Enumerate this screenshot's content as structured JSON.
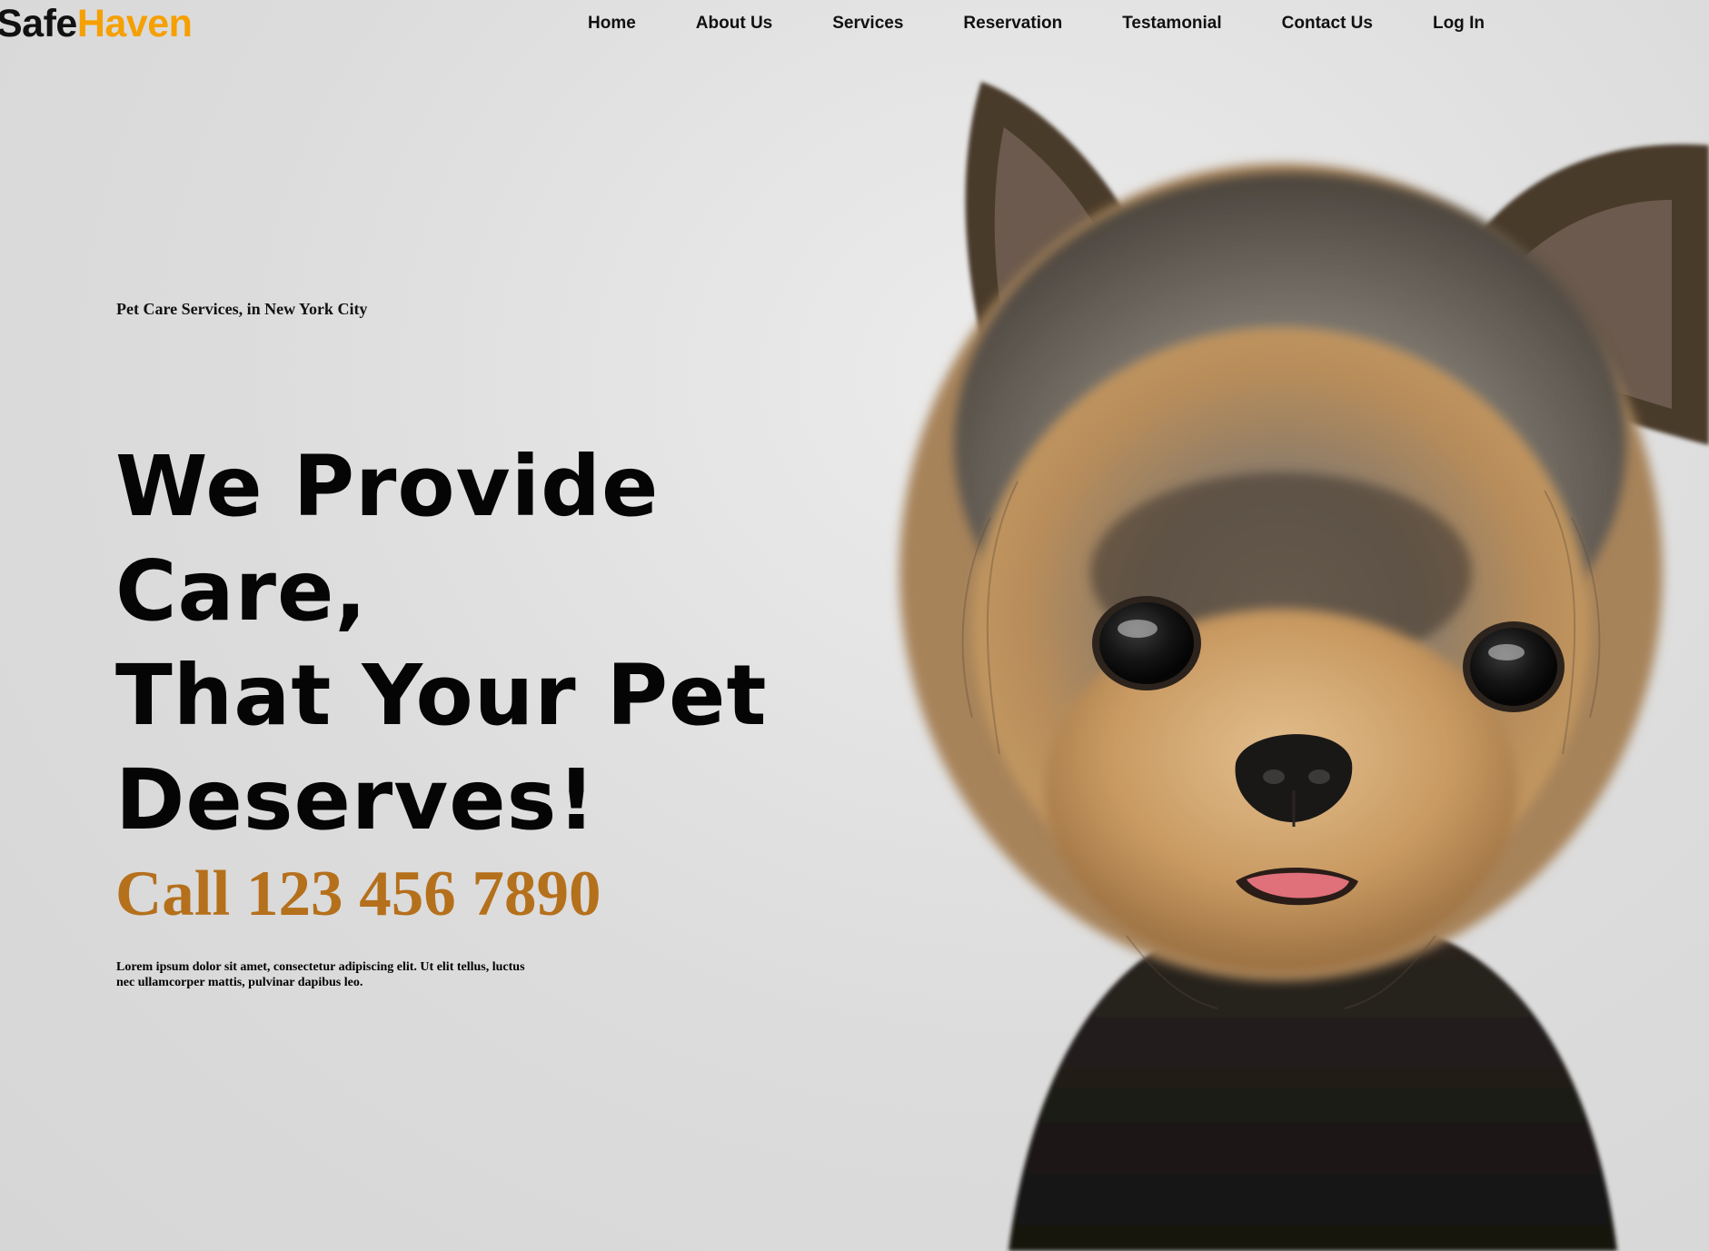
{
  "brand": {
    "part1": "Safe",
    "part2": "Haven",
    "accent_color": "#f5a000"
  },
  "nav": {
    "items": [
      "Home",
      "About Us",
      "Services",
      "Reservation",
      "Testamonial",
      "Contact Us",
      "Log In"
    ]
  },
  "hero": {
    "tagline": "Pet Care Services, in New York City",
    "headline_lines": [
      "We Provide Care,",
      "That Your Pet",
      "Deserves!"
    ],
    "phone": "Call 123 456 7890",
    "phone_color": "#b5701c",
    "blurb_line1": "Lorem ipsum dolor sit amet, consectetur adipiscing elit. Ut elit tellus, luctus",
    "blurb_line2": "nec ullamcorper mattis, pulvinar dapibus leo."
  },
  "image": {
    "subject": "yorkshire-terrier-photo"
  }
}
